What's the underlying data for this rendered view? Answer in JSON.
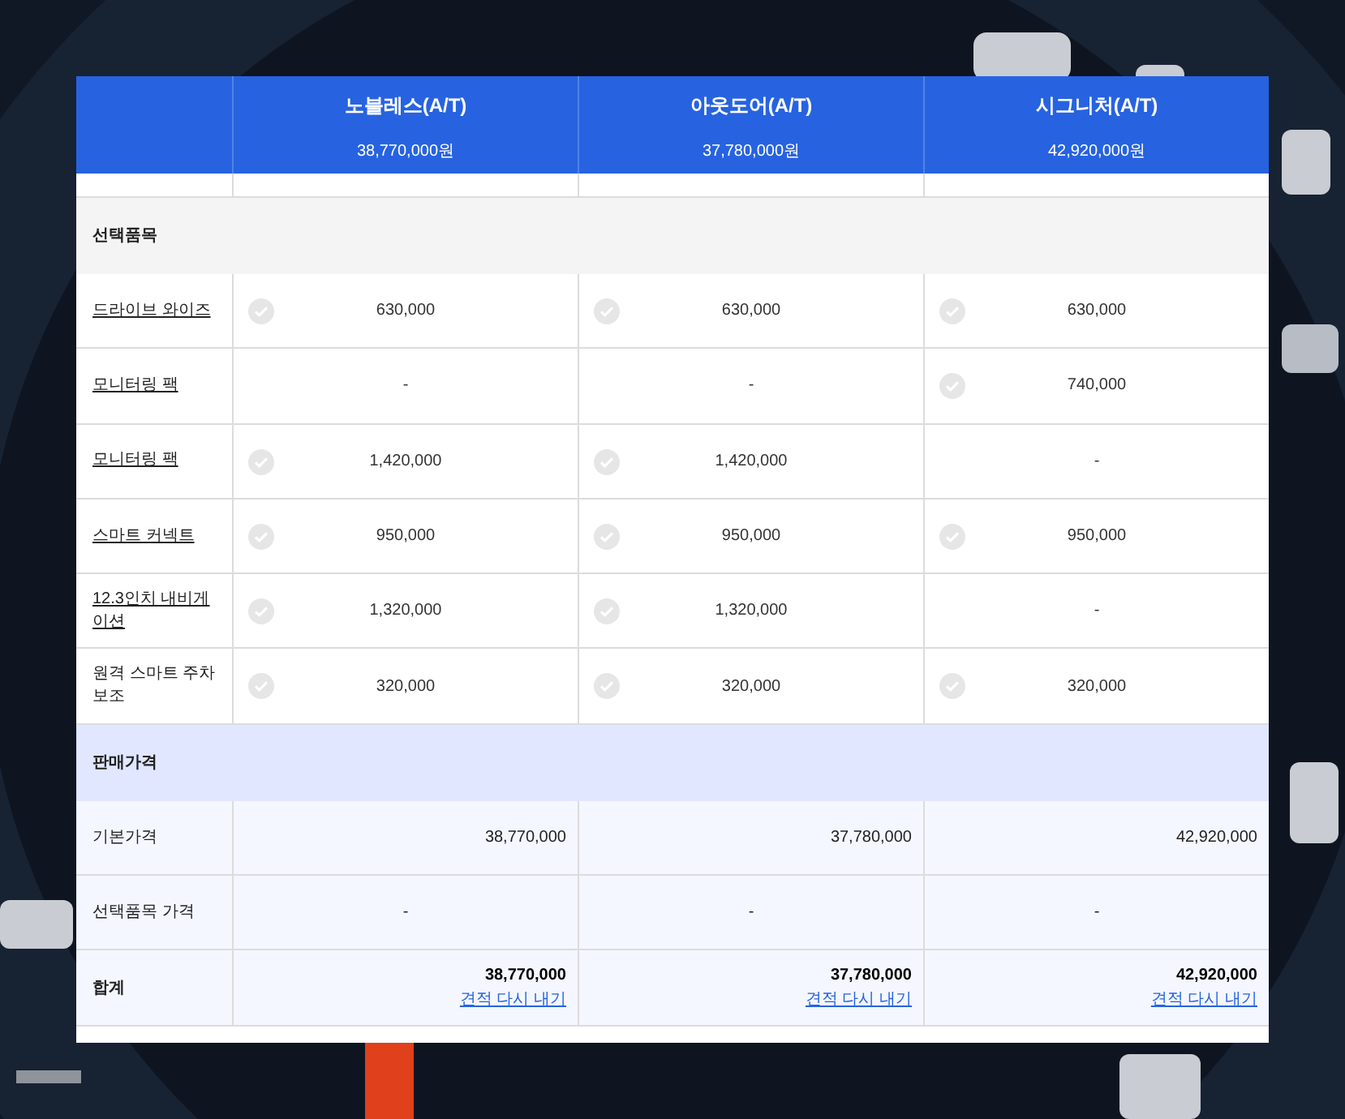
{
  "models": [
    {
      "name": "노블레스(A/T)",
      "price": "38,770,000원"
    },
    {
      "name": "아웃도어(A/T)",
      "price": "37,780,000원"
    },
    {
      "name": "시그니처(A/T)",
      "price": "42,920,000원"
    }
  ],
  "options_section": {
    "title": "선택품목"
  },
  "options": [
    {
      "name": "드라이브 와이즈",
      "link": true,
      "cells": [
        {
          "included": true,
          "value": "630,000"
        },
        {
          "included": true,
          "value": "630,000"
        },
        {
          "included": true,
          "value": "630,000"
        }
      ]
    },
    {
      "name": "모니터링 팩",
      "link": true,
      "cells": [
        {
          "included": false,
          "value": "-"
        },
        {
          "included": false,
          "value": "-"
        },
        {
          "included": true,
          "value": "740,000"
        }
      ]
    },
    {
      "name": "모니터링 팩",
      "link": true,
      "cells": [
        {
          "included": true,
          "value": "1,420,000"
        },
        {
          "included": true,
          "value": "1,420,000"
        },
        {
          "included": false,
          "value": "-"
        }
      ]
    },
    {
      "name": "스마트 커넥트",
      "link": true,
      "cells": [
        {
          "included": true,
          "value": "950,000"
        },
        {
          "included": true,
          "value": "950,000"
        },
        {
          "included": true,
          "value": "950,000"
        }
      ]
    },
    {
      "name": "12.3인치 내비게이션",
      "link": true,
      "cells": [
        {
          "included": true,
          "value": "1,320,000"
        },
        {
          "included": true,
          "value": "1,320,000"
        },
        {
          "included": false,
          "value": "-"
        }
      ]
    },
    {
      "name": "원격 스마트 주차 보조",
      "link": false,
      "cells": [
        {
          "included": true,
          "value": "320,000"
        },
        {
          "included": true,
          "value": "320,000"
        },
        {
          "included": true,
          "value": "320,000"
        }
      ]
    }
  ],
  "price_section": {
    "title": "판매가격"
  },
  "price_rows": [
    {
      "kind": "base",
      "label": "기본가격",
      "values": [
        "38,770,000",
        "37,780,000",
        "42,920,000"
      ]
    },
    {
      "kind": "options",
      "label": "선택품목 가격",
      "values": [
        "-",
        "-",
        "-"
      ]
    },
    {
      "kind": "total",
      "label": "합계",
      "values": [
        "38,770,000",
        "37,780,000",
        "42,920,000"
      ],
      "links": [
        "견적 다시 내기",
        "견적 다시 내기",
        "견적 다시 내기"
      ]
    }
  ]
}
